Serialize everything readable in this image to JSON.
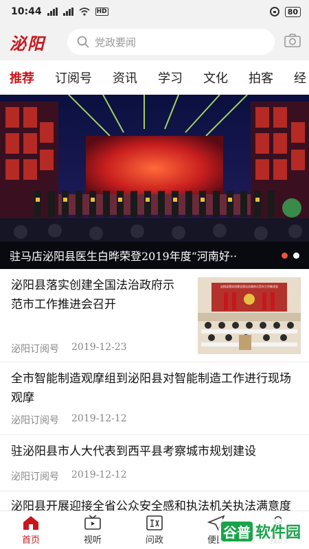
{
  "status": {
    "time": "10:44",
    "battery": "80"
  },
  "header": {
    "logo": "泌阳",
    "search_placeholder": "党政要闻"
  },
  "tabs": [
    "推荐",
    "订阅号",
    "资讯",
    "学习",
    "文化",
    "拍客",
    "经"
  ],
  "banner": {
    "title": "驻马店泌阳县医生白晔荣登2019年度“河南好··"
  },
  "news": [
    {
      "title_lines": [
        "泌阳县落实创建全国法治政府示",
        "范市工作推进会召开"
      ],
      "source": "泌阳订阅号",
      "date": "2019-12-23",
      "thumb_caption": "泌阳县落实创建全国法治政府示范市工作推进会"
    },
    {
      "title_lines": [
        "全市智能制造观摩组到泌阳县对智能制造工作进行现场",
        "观摩"
      ],
      "source": "泌阳订阅号",
      "date": "2019-12-12"
    },
    {
      "title_lines": [
        "驻泌阳县市人大代表到西平县考察城市规划建设"
      ],
      "source": "泌阳订阅号",
      "date": "2019-12-12"
    },
    {
      "title_lines": [
        "泌阳县开展迎接全省公众安全感和执法机关执法满意度"
      ]
    }
  ],
  "tabbar": [
    {
      "label": "首页",
      "icon": "home-icon"
    },
    {
      "label": "视听",
      "icon": "tv-icon"
    },
    {
      "label": "问政",
      "icon": "zheng-icon"
    },
    {
      "label": "便民",
      "icon": "send-icon"
    },
    {
      "label": "我的",
      "icon": "user-icon"
    }
  ],
  "watermark": {
    "badge": "谷普",
    "text": "软件园"
  },
  "colors": {
    "accent": "#c8161d"
  }
}
